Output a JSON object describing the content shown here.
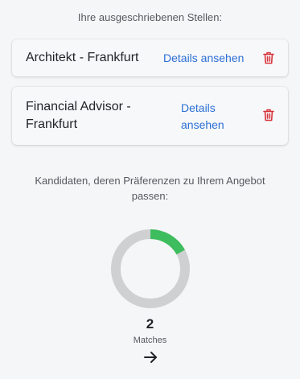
{
  "header": {
    "title": "Ihre ausgeschriebenen Stellen:"
  },
  "jobs": [
    {
      "title": "Architekt - Frankfurt",
      "details_label": "Details ansehen",
      "delete_icon": "trash-icon"
    },
    {
      "title": "Financial Advisor - Frankfurt",
      "details_label": "Details ansehen",
      "delete_icon": "trash-icon"
    }
  ],
  "candidates": {
    "title": "Kandidaten, deren Präferenzen zu Ihrem Angebot passen:",
    "match_count": "2",
    "match_label": "Matches",
    "match_fraction": 0.17,
    "colors": {
      "match": "#3dbd5e",
      "rest": "#cfd0d2"
    },
    "arrow_icon": "arrow-right-icon"
  },
  "colors": {
    "link": "#2b6fd6",
    "delete": "#d6343a"
  }
}
